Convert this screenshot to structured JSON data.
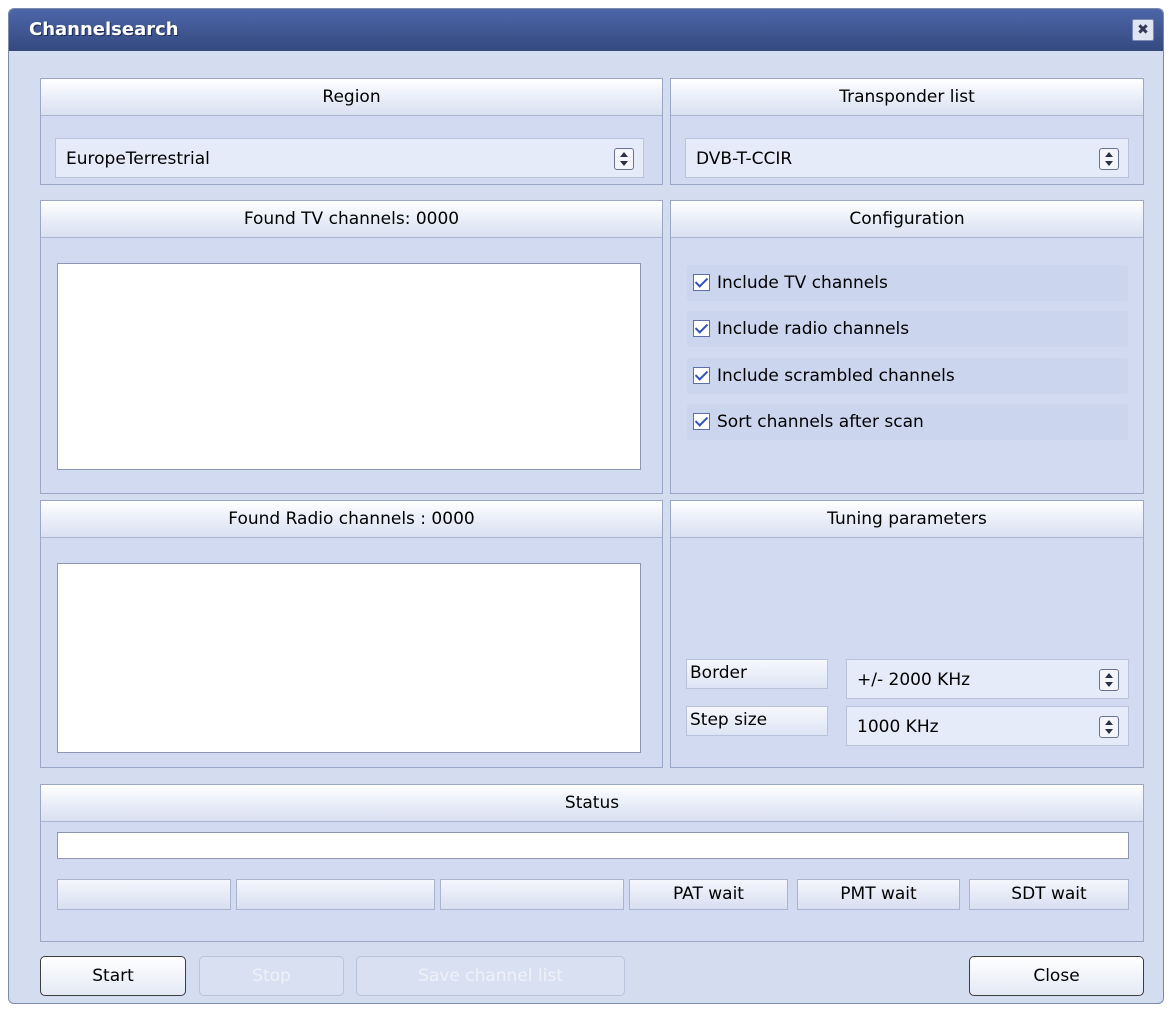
{
  "window": {
    "title": "Channelsearch",
    "close_glyph": "✖"
  },
  "region": {
    "header": "Region",
    "value": "EuropeTerrestrial"
  },
  "transponder": {
    "header": "Transponder list",
    "value": "DVB-T-CCIR"
  },
  "tv": {
    "header": "Found TV channels: 0000"
  },
  "radio": {
    "header": "Found Radio channels : 0000"
  },
  "configuration": {
    "header": "Configuration",
    "options": [
      {
        "label": "Include TV channels",
        "checked": true
      },
      {
        "label": "Include radio channels",
        "checked": true
      },
      {
        "label": "Include scrambled channels",
        "checked": true
      },
      {
        "label": "Sort channels after scan",
        "checked": true
      }
    ]
  },
  "tuning": {
    "header": "Tuning parameters",
    "border_label": "Border",
    "border_value": "+/-  2000 KHz",
    "step_label": "Step size",
    "step_value": "1000 KHz"
  },
  "status": {
    "header": "Status",
    "cells": [
      "",
      "",
      "",
      "PAT wait",
      "PMT wait",
      "SDT wait"
    ]
  },
  "buttons": {
    "start": "Start",
    "stop": "Stop",
    "save": "Save channel list",
    "close": "Close"
  }
}
